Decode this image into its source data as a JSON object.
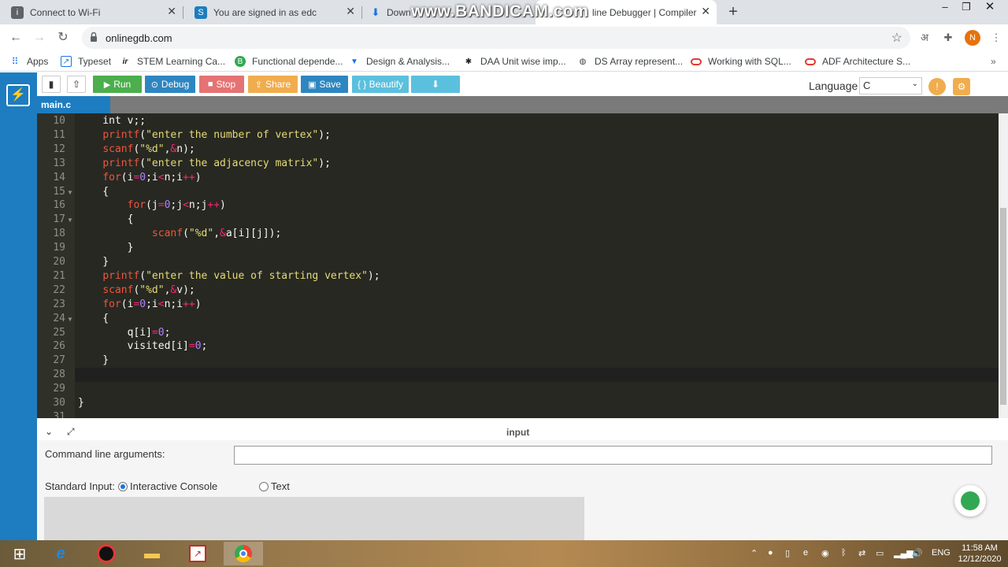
{
  "browser": {
    "tabs": [
      {
        "title": "Connect to Wi-Fi",
        "icon": "info-icon"
      },
      {
        "title": "You are signed in as edc",
        "icon": "s-logo-icon"
      },
      {
        "title": "Down",
        "icon": "download-icon"
      },
      {
        "title": "line Debugger | Compiler",
        "icon": "onlinegdb-icon"
      }
    ],
    "watermark": "www.BANDICAM.com",
    "url": "onlinegdb.com",
    "profile_initial": "N",
    "extension_label": "अ"
  },
  "bookmarks": [
    {
      "label": "Apps",
      "icon": "apps-grid-icon"
    },
    {
      "label": "Typeset",
      "icon": "typeset-icon"
    },
    {
      "label": "STEM Learning Ca...",
      "icon": "ir-logo-icon"
    },
    {
      "label": "Functional depende...",
      "icon": "b-logo-icon"
    },
    {
      "label": "Design & Analysis...",
      "icon": "design-icon"
    },
    {
      "label": "DAA Unit wise imp...",
      "icon": "puzzle-icon"
    },
    {
      "label": "DS Array represent...",
      "icon": "globe-icon"
    },
    {
      "label": "Working with SQL...",
      "icon": "oracle-icon"
    },
    {
      "label": "ADF Architecture S...",
      "icon": "oracle-icon"
    }
  ],
  "app": {
    "buttons": {
      "run": "Run",
      "debug": "Debug",
      "stop": "Stop",
      "share": "Share",
      "save": "Save",
      "beautify": "{ } Beautify"
    },
    "language_label": "Language",
    "language_value": "C",
    "file_tab": "main.c",
    "colors": {
      "accent": "#1d7dc0",
      "run": "#4cae4c",
      "debug": "#2e86c1",
      "stop": "#e57373",
      "share": "#f0ad4e",
      "beautify": "#5bc0de"
    }
  },
  "editor": {
    "line_numbers": [
      "10",
      "11",
      "12",
      "13",
      "14",
      "15",
      "16",
      "17",
      "18",
      "19",
      "20",
      "21",
      "22",
      "23",
      "24",
      "25",
      "26",
      "27",
      "28",
      "29",
      "30",
      "31"
    ],
    "lines": [
      "    int v;;",
      "    printf(\"enter the number of vertex\");",
      "    scanf(\"%d\",&n);",
      "    printf(\"enter the adjacency matrix\");",
      "    for(i=0;i<n;i++)",
      "    {",
      "        for(j=0;j<n;j++)",
      "        {",
      "            scanf(\"%d\",&a[i][j]);",
      "        }",
      "    }",
      "    printf(\"enter the value of starting vertex\");",
      "    scanf(\"%d\",&v);",
      "    for(i=0;i<n;i++)",
      "    {",
      "        q[i]=0;",
      "        visited[i]=0;",
      "    }",
      "",
      "",
      "}",
      ""
    ]
  },
  "input_panel": {
    "title": "input",
    "cmd_label": "Command line arguments:",
    "stdin_label": "Standard Input:",
    "option_console": "Interactive Console",
    "option_text": "Text",
    "selected": "Interactive Console"
  },
  "taskbar": {
    "language": "ENG",
    "time": "11:58 AM",
    "date": "12/12/2020"
  }
}
